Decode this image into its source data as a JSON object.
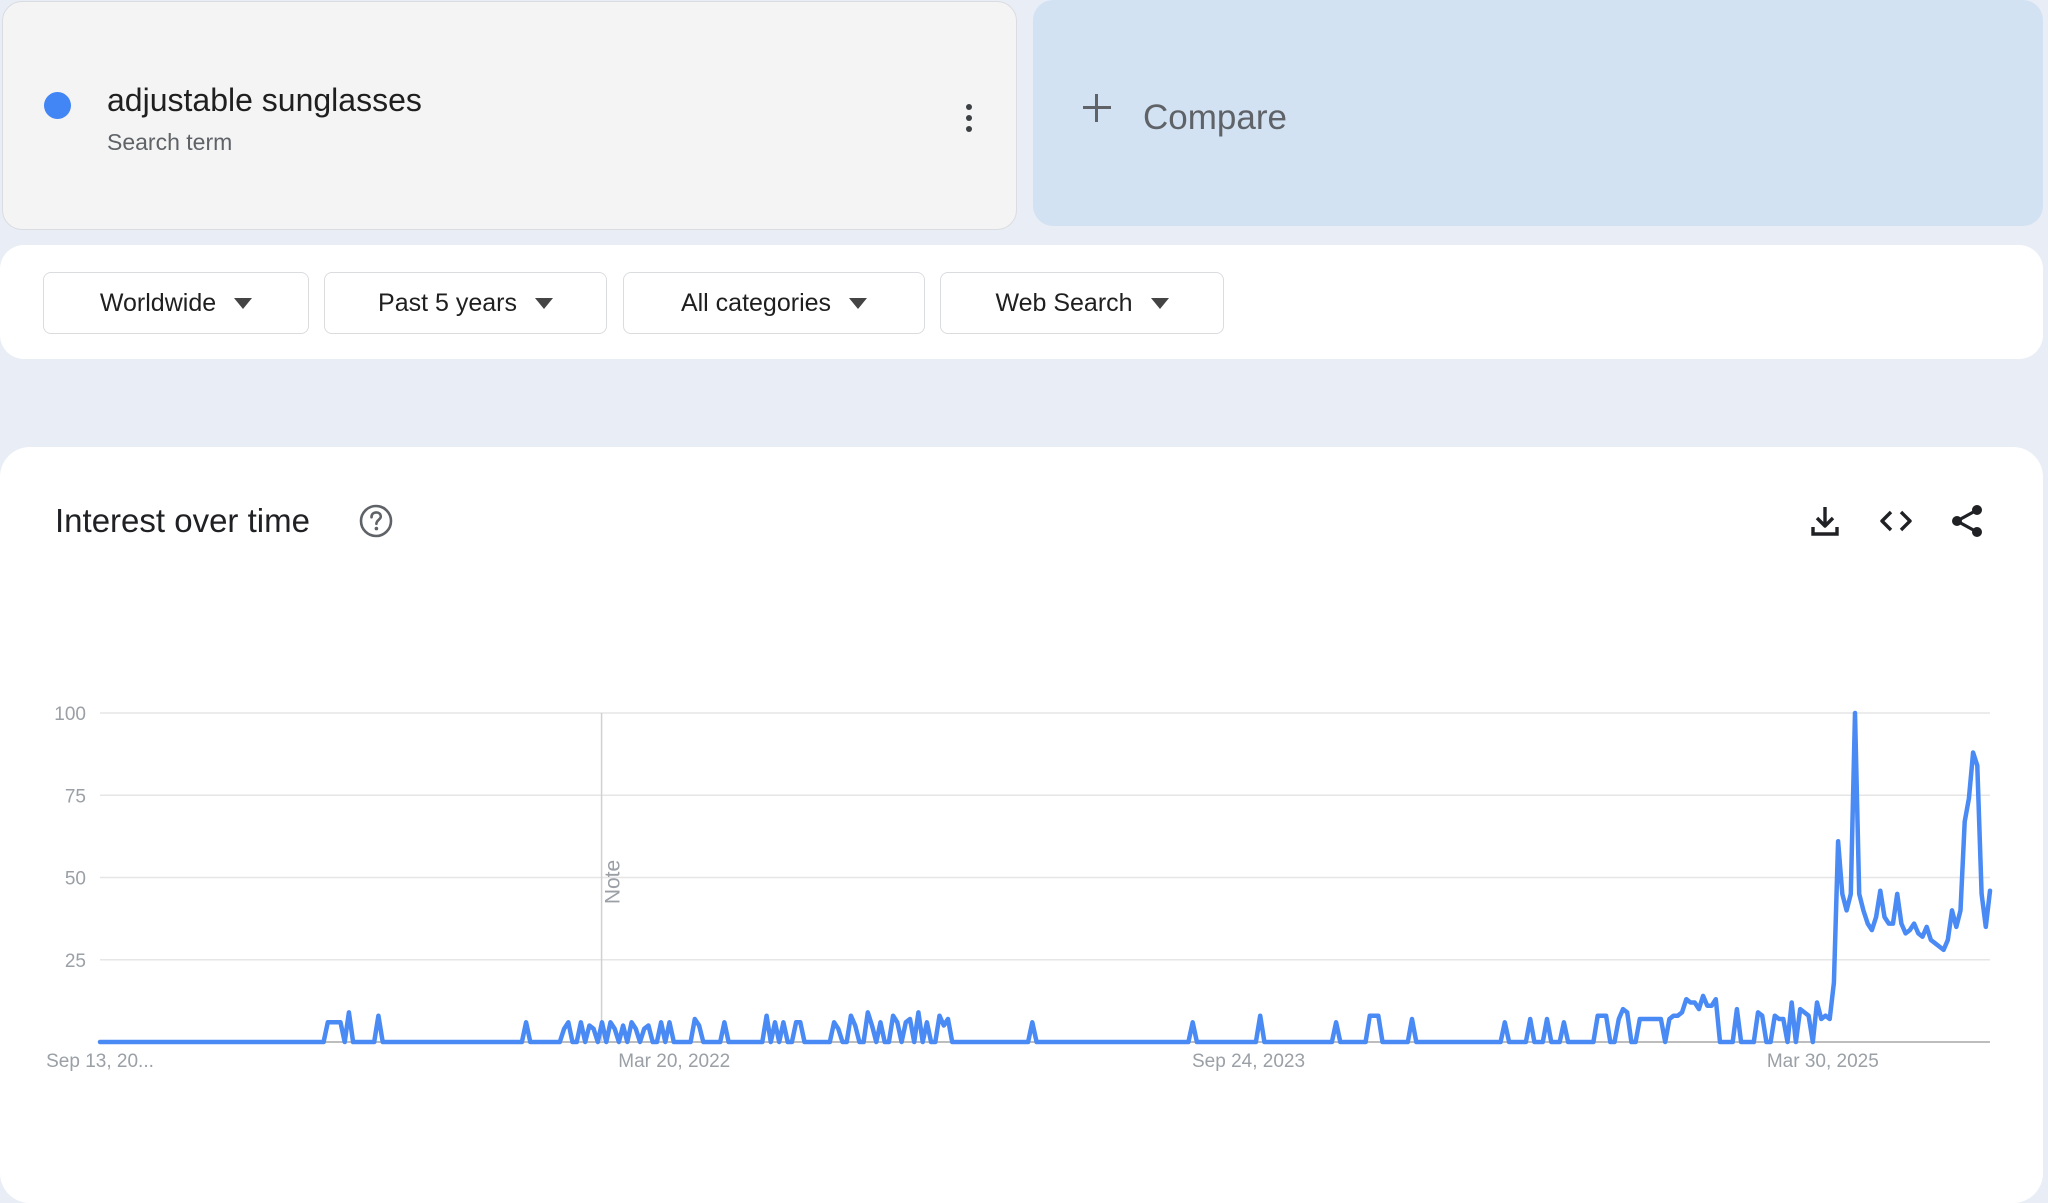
{
  "search_term": {
    "name": "adjustable sunglasses",
    "type": "Search term",
    "color": "#4285f4"
  },
  "compare": {
    "label": "Compare"
  },
  "filters": [
    {
      "label": "Worldwide"
    },
    {
      "label": "Past 5 years"
    },
    {
      "label": "All categories"
    },
    {
      "label": "Web Search"
    }
  ],
  "chart_card": {
    "title": "Interest over time",
    "icons": [
      "help-icon",
      "download-icon",
      "embed-icon",
      "share-icon"
    ]
  },
  "chart_data": {
    "type": "line",
    "title": "Interest over time",
    "xlabel": "",
    "ylabel": "",
    "ylim": [
      0,
      100
    ],
    "yticks": [
      100,
      75,
      50,
      25
    ],
    "x_tick_labels": [
      "Sep 13, 20...",
      "Mar 20, 2022",
      "Sep 24, 2023",
      "Mar 30, 2025"
    ],
    "x_start": "2020-09-13",
    "x_end": "2025-09-07",
    "note_date": "2022-01-09",
    "note_label": "Note",
    "line_color": "#4a8af4",
    "grid": true,
    "series": [
      {
        "name": "adjustable sunglasses",
        "values": [
          0,
          0,
          0,
          0,
          0,
          0,
          0,
          0,
          0,
          0,
          0,
          0,
          0,
          0,
          0,
          0,
          0,
          0,
          0,
          0,
          0,
          0,
          0,
          0,
          0,
          0,
          0,
          0,
          0,
          0,
          0,
          0,
          0,
          0,
          0,
          0,
          0,
          0,
          0,
          0,
          0,
          0,
          0,
          0,
          0,
          0,
          0,
          0,
          0,
          0,
          0,
          0,
          0,
          0,
          6,
          6,
          6,
          6,
          0,
          9,
          0,
          0,
          0,
          0,
          0,
          0,
          8,
          0,
          0,
          0,
          0,
          0,
          0,
          0,
          0,
          0,
          0,
          0,
          0,
          0,
          0,
          0,
          0,
          0,
          0,
          0,
          0,
          0,
          0,
          0,
          0,
          0,
          0,
          0,
          0,
          0,
          0,
          0,
          0,
          0,
          0,
          6,
          0,
          0,
          0,
          0,
          0,
          0,
          0,
          0,
          4,
          6,
          0,
          0,
          6,
          0,
          5,
          4,
          0,
          6,
          0,
          6,
          4,
          0,
          5,
          0,
          6,
          4,
          0,
          4,
          5,
          0,
          0,
          6,
          0,
          6,
          0,
          0,
          0,
          0,
          0,
          7,
          5,
          0,
          0,
          0,
          0,
          0,
          6,
          0,
          0,
          0,
          0,
          0,
          0,
          0,
          0,
          0,
          8,
          0,
          6,
          0,
          6,
          0,
          0,
          6,
          6,
          0,
          0,
          0,
          0,
          0,
          0,
          0,
          6,
          4,
          0,
          0,
          8,
          5,
          0,
          0,
          9,
          5,
          0,
          6,
          0,
          0,
          8,
          6,
          0,
          6,
          7,
          0,
          9,
          0,
          6,
          0,
          0,
          8,
          5,
          7,
          0,
          0,
          0,
          0,
          0,
          0,
          0,
          0,
          0,
          0,
          0,
          0,
          0,
          0,
          0,
          0,
          0,
          0,
          0,
          6,
          0,
          0,
          0,
          0,
          0,
          0,
          0,
          0,
          0,
          0,
          0,
          0,
          0,
          0,
          0,
          0,
          0,
          0,
          0,
          0,
          0,
          0,
          0,
          0,
          0,
          0,
          0,
          0,
          0,
          0,
          0,
          0,
          0,
          0,
          0,
          0,
          0,
          6,
          0,
          0,
          0,
          0,
          0,
          0,
          0,
          0,
          0,
          0,
          0,
          0,
          0,
          0,
          0,
          8,
          0,
          0,
          0,
          0,
          0,
          0,
          0,
          0,
          0,
          0,
          0,
          0,
          0,
          0,
          0,
          0,
          0,
          6,
          0,
          0,
          0,
          0,
          0,
          0,
          0,
          8,
          8,
          8,
          0,
          0,
          0,
          0,
          0,
          0,
          0,
          7,
          0,
          0,
          0,
          0,
          0,
          0,
          0,
          0,
          0,
          0,
          0,
          0,
          0,
          0,
          0,
          0,
          0,
          0,
          0,
          0,
          0,
          6,
          0,
          0,
          0,
          0,
          0,
          7,
          0,
          0,
          0,
          7,
          0,
          0,
          0,
          6,
          0,
          0,
          0,
          0,
          0,
          0,
          0,
          8,
          8,
          8,
          0,
          0,
          7,
          10,
          9,
          0,
          0,
          7,
          7,
          7,
          7,
          7,
          7,
          0,
          7,
          8,
          8,
          9,
          13,
          12,
          12,
          10,
          14,
          11,
          11,
          13,
          0,
          0,
          0,
          0,
          10,
          0,
          0,
          0,
          0,
          9,
          8,
          0,
          0,
          8,
          7,
          7,
          0,
          12,
          0,
          10,
          9,
          8,
          0,
          12,
          7,
          8,
          7,
          18,
          61,
          45,
          40,
          45,
          100,
          45,
          40,
          36,
          34,
          38,
          46,
          38,
          36,
          36,
          45,
          36,
          33,
          34,
          36,
          33,
          32,
          35,
          31,
          30,
          29,
          28,
          31,
          40,
          35,
          40,
          67,
          74,
          88,
          84,
          45,
          35,
          46
        ]
      }
    ]
  }
}
